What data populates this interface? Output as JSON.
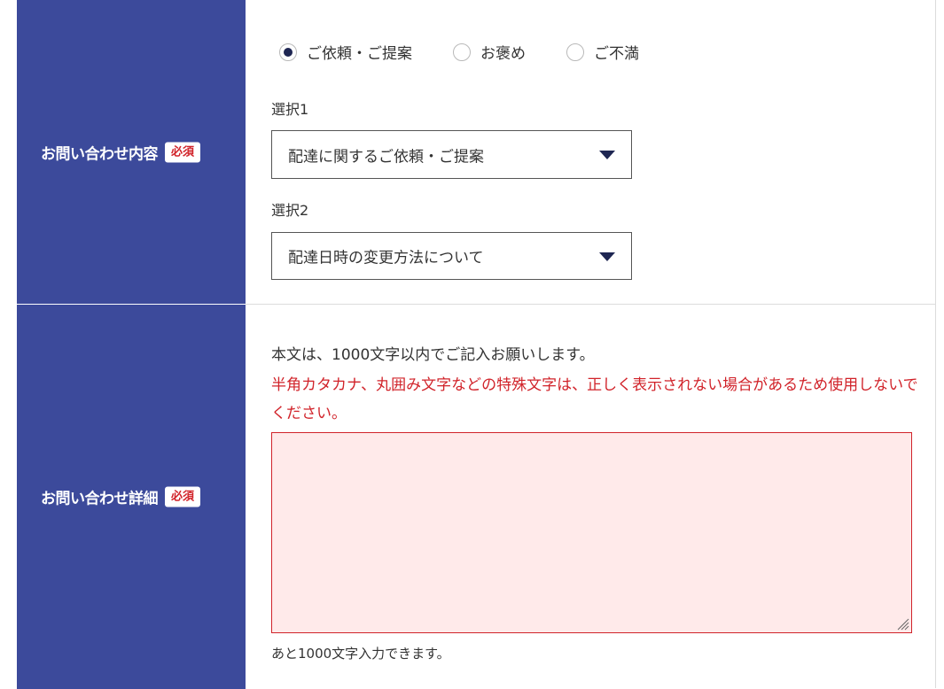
{
  "inquiry_type": {
    "label": "お問い合わせ内容",
    "required_badge": "必須",
    "radios": [
      {
        "label": "ご依頼・ご提案",
        "checked": true
      },
      {
        "label": "お褒め",
        "checked": false
      },
      {
        "label": "ご不満",
        "checked": false
      }
    ],
    "select1": {
      "label": "選択1",
      "value": "配達に関するご依頼・ご提案"
    },
    "select2": {
      "label": "選択2",
      "value": "配達日時の変更方法について"
    }
  },
  "inquiry_detail": {
    "label": "お問い合わせ詳細",
    "required_badge": "必須",
    "note": "本文は、1000文字以内でご記入お願いします。",
    "warning": "半角カタカナ、丸囲み文字などの特殊文字は、正しく表示されない場合があるため使用しないでください。",
    "textarea_value": "",
    "counter": "あと1000文字入力できます。"
  },
  "colors": {
    "header_bg": "#3c4a9b",
    "accent_red": "#d1232a",
    "textarea_bg": "#ffeaea",
    "radio_dot": "#1e2652"
  }
}
